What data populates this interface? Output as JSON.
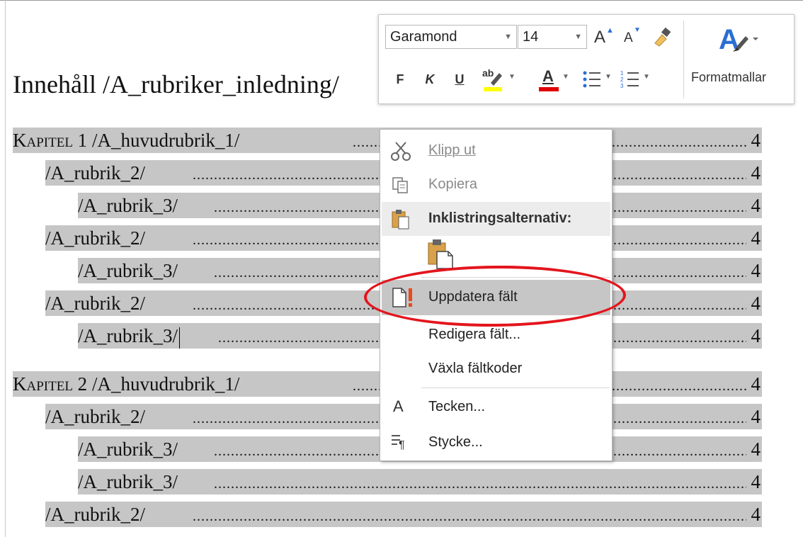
{
  "document": {
    "title": "Innehåll /A_rubriker_inledning/",
    "toc": [
      {
        "label_sc": "Kapitel 1",
        "label_rest": " /A_huvudrubrik_1/",
        "level": 1,
        "page": "4"
      },
      {
        "label": "/A_rubrik_2/",
        "level": 2,
        "page": "4"
      },
      {
        "label": "/A_rubrik_3/",
        "level": 3,
        "page": "4"
      },
      {
        "label": "/A_rubrik_2/",
        "level": 2,
        "page": "4"
      },
      {
        "label": "/A_rubrik_3/",
        "level": 3,
        "page": "4"
      },
      {
        "label": "/A_rubrik_2/",
        "level": 2,
        "page": "4"
      },
      {
        "label": "/A_rubrik_3/",
        "level": 3,
        "page": "4"
      },
      {
        "label_sc": "Kapitel 2",
        "label_rest": " /A_huvudrubrik_1/",
        "level": 1,
        "page": "4"
      },
      {
        "label": "/A_rubrik_2/",
        "level": 2,
        "page": "4"
      },
      {
        "label": "/A_rubrik_3/",
        "level": 3,
        "page": "4"
      },
      {
        "label": "/A_rubrik_3/",
        "level": 3,
        "page": "4"
      },
      {
        "label": "/A_rubrik_2/",
        "level": 2,
        "page": "4"
      }
    ]
  },
  "mini_toolbar": {
    "font_name": "Garamond",
    "font_size": "14",
    "grow_font_glyph": "A",
    "shrink_font_glyph": "A",
    "bold_glyph": "F",
    "italic_glyph": "K",
    "underline_glyph": "U",
    "highlight_glyph": "ab",
    "font_color_glyph": "A",
    "styles_label": "Formatmallar",
    "icons": [
      "grow-font-icon",
      "shrink-font-icon",
      "format-painter-icon",
      "bullets-icon",
      "numbering-icon",
      "styles-icon"
    ],
    "colors": {
      "highlight": "#ffff00",
      "font_color": "#e00000",
      "styles_blue": "#2b6fd3"
    }
  },
  "context_menu": {
    "items": {
      "cut": "Klipp ut",
      "copy": "Kopiera",
      "paste_header": "Inklistringsalternativ:",
      "update_field": "Uppdatera fält",
      "edit_field": "Redigera fält...",
      "toggle_codes": "Växla fältkoder",
      "font": "Tecken...",
      "paragraph": "Stycke..."
    },
    "icons": [
      "scissors-icon",
      "copy-icon",
      "clipboard-icon",
      "paste-keep-formatting-icon",
      "update-field-icon",
      "font-a-icon",
      "paragraph-icon"
    ],
    "colors": {
      "highlight_bg": "#c6c6c6",
      "annotation_red": "#e3151d",
      "update_icon_red": "#e8491d"
    }
  }
}
